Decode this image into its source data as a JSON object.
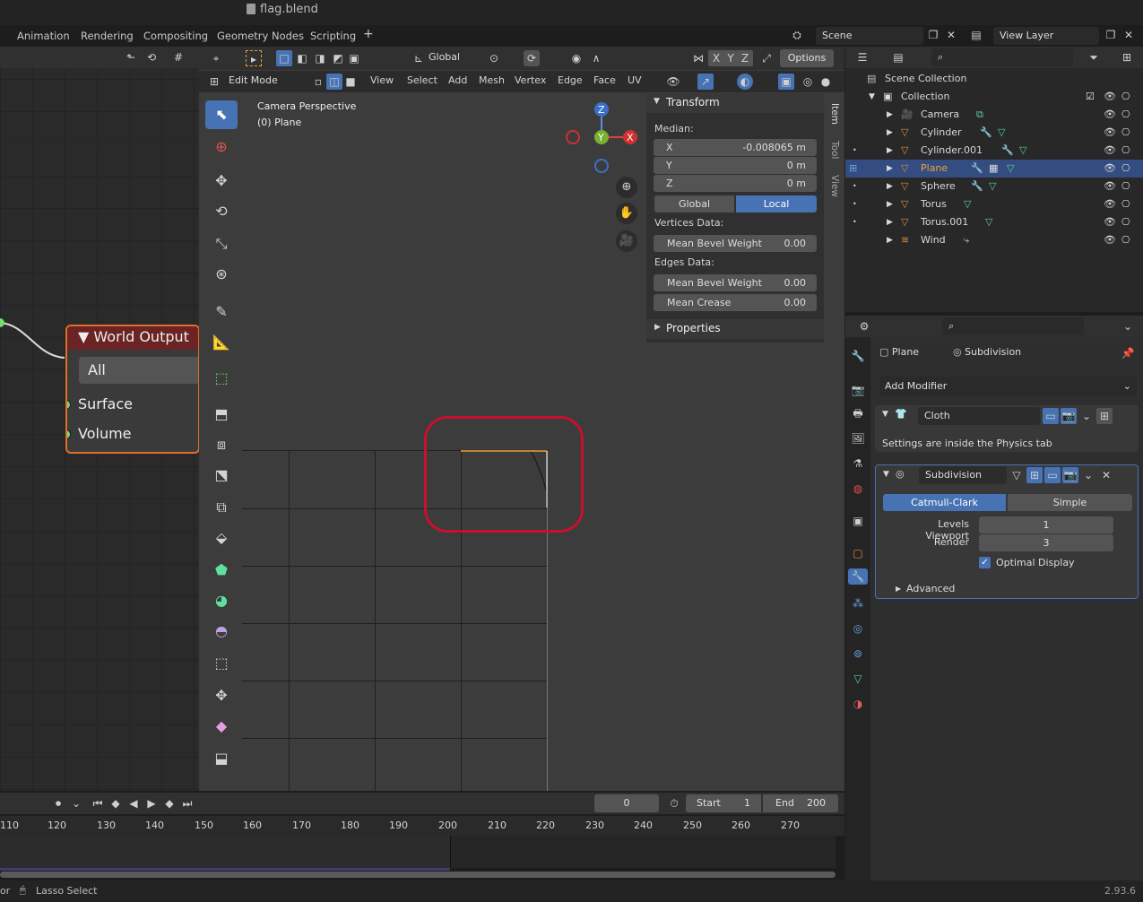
{
  "title": "flag.blend",
  "workspaces": [
    "Animation",
    "Rendering",
    "Compositing",
    "Geometry Nodes",
    "Scripting"
  ],
  "add_tab": "+",
  "scene": "Scene",
  "view_layer": "View Layer",
  "node": {
    "title": "World Output",
    "target": "All",
    "socket1": "Surface",
    "socket2": "Volume"
  },
  "viewport": {
    "mode": "Edit Mode",
    "menus": [
      "View",
      "Select",
      "Add",
      "Mesh",
      "Vertex",
      "Edge",
      "Face",
      "UV"
    ],
    "transform_orientation": "Global",
    "options": "Options",
    "camera_label": "Camera Perspective",
    "object_label": "(0) Plane",
    "axes": [
      "X",
      "Y",
      "Z"
    ]
  },
  "npanel": {
    "tabs": [
      "Item",
      "Tool",
      "View"
    ],
    "transform_header": "Transform",
    "median": "Median:",
    "x_label": "X",
    "x_value": "-0.008065 m",
    "y_label": "Y",
    "y_value": "0 m",
    "z_label": "Z",
    "z_value": "0 m",
    "global": "Global",
    "local": "Local",
    "vertices_data": "Vertices Data:",
    "mean_bevel_weight": "Mean Bevel Weight",
    "vbw_value": "0.00",
    "edges_data": "Edges Data:",
    "ebw_value": "0.00",
    "mean_crease": "Mean Crease",
    "crease_value": "0.00",
    "properties": "Properties"
  },
  "outliner": {
    "scene_collection": "Scene Collection",
    "collection": "Collection",
    "items": [
      "Camera",
      "Cylinder",
      "Cylinder.001",
      "Plane",
      "Sphere",
      "Torus",
      "Torus.001",
      "Wind"
    ]
  },
  "properties": {
    "object": "Plane",
    "modifier_ctx": "Subdivision",
    "add_modifier": "Add Modifier",
    "cloth_name": "Cloth",
    "cloth_note": "Settings are inside the Physics tab",
    "subdiv_name": "Subdivision",
    "catmull": "Catmull-Clark",
    "simple": "Simple",
    "levels_label": "Levels Viewport",
    "levels_value": "1",
    "render_label": "Render",
    "render_value": "3",
    "optimal": "Optimal Display",
    "advanced": "Advanced"
  },
  "timeline": {
    "current_frame": "0",
    "start_label": "Start",
    "start": "1",
    "end_label": "End",
    "end": "200",
    "ruler": [
      "110",
      "120",
      "130",
      "140",
      "150",
      "160",
      "170",
      "180",
      "190",
      "200",
      "210",
      "220",
      "230",
      "240",
      "250",
      "260",
      "270"
    ]
  },
  "status": {
    "left": "or",
    "action": "Lasso Select",
    "version": "2.93.6"
  },
  "colors": {
    "accent": "#4772b3",
    "selected_row": "#334d80",
    "highlight_ring": "#c8102e",
    "node_header": "#6b2323"
  }
}
